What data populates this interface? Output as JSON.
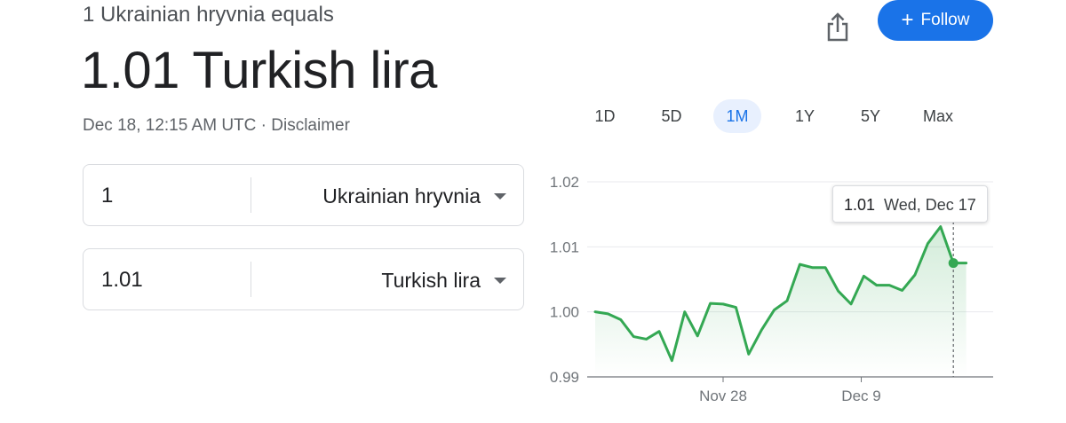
{
  "header": {
    "subtitle": "1 Ukrainian hryvnia equals",
    "value_line": "1.01 Turkish lira",
    "timestamp": "Dec 18, 12:15 AM UTC",
    "separator": " · ",
    "disclaimer": "Disclaimer"
  },
  "actions": {
    "share_icon": "share-icon",
    "follow_icon": "plus",
    "follow_label": "Follow",
    "follow_color": "#1a73e8"
  },
  "converter": {
    "from": {
      "amount": "1",
      "currency": "Ukrainian hryvnia"
    },
    "to": {
      "amount": "1.01",
      "currency": "Turkish lira"
    }
  },
  "range_tabs": {
    "items": [
      "1D",
      "5D",
      "1M",
      "1Y",
      "5Y",
      "Max"
    ],
    "selected": "1M"
  },
  "tooltip": {
    "value": "1.01",
    "date": "Wed, Dec 17"
  },
  "chart_data": {
    "type": "line",
    "title": "",
    "xlabel": "",
    "ylabel": "",
    "ylim": [
      0.99,
      1.02
    ],
    "y_ticks": [
      "1.02",
      "1.01",
      "1.00",
      "0.99"
    ],
    "x_tick_labels": [
      "Nov 28",
      "Dec 9"
    ],
    "grid": true,
    "line_color": "#34a853",
    "series": [
      {
        "values": [
          1.0,
          0.9997,
          0.9988,
          0.9962,
          0.9958,
          0.997,
          0.9925,
          1.0,
          0.9963,
          1.0013,
          1.0012,
          1.0007,
          0.9935,
          0.9972,
          1.0003,
          1.0017,
          1.0073,
          1.0068,
          1.0068,
          1.0032,
          1.0012,
          1.0055,
          1.0041,
          1.0041,
          1.0033,
          1.0057,
          1.0105,
          1.0131,
          1.0075,
          1.0075
        ]
      }
    ],
    "highlight_index": 28
  }
}
